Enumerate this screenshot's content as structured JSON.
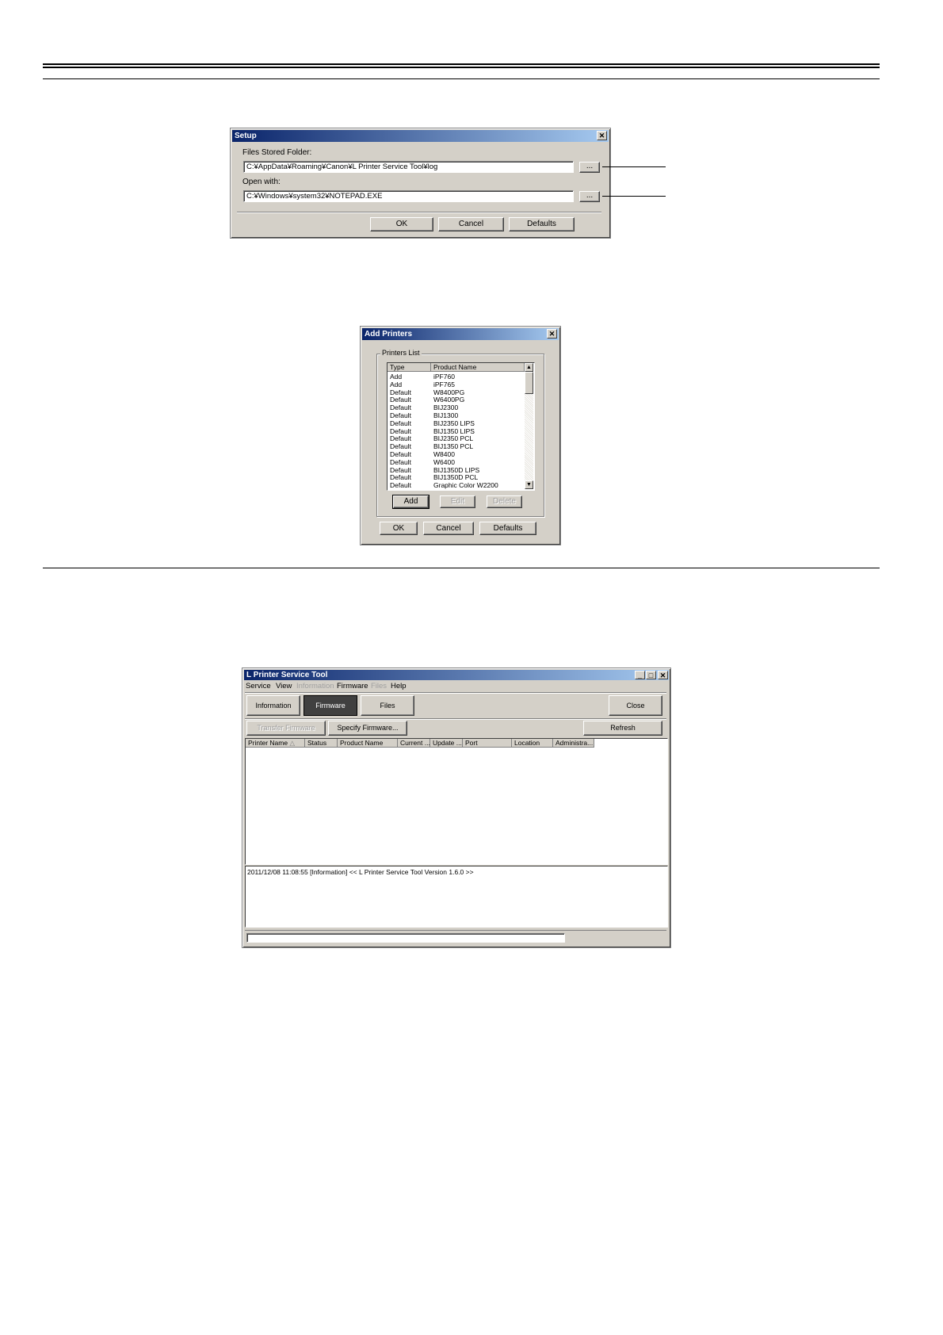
{
  "setup_dialog": {
    "title": "Setup",
    "close_glyph": "✕",
    "files_stored_folder_label": "Files Stored Folder:",
    "files_stored_folder_value": "C:¥AppData¥Roaming¥Canon¥L Printer Service Tool¥log",
    "browse_label": "...",
    "open_with_label": "Open with:",
    "open_with_value": "C:¥Windows¥system32¥NOTEPAD.EXE",
    "ok_label": "OK",
    "cancel_label": "Cancel",
    "defaults_label": "Defaults"
  },
  "add_printers_dialog": {
    "title": "Add Printers",
    "close_glyph": "✕",
    "group_label": "Printers List",
    "columns": [
      "Type",
      "Product Name"
    ],
    "rows": [
      [
        "Add",
        "iPF760"
      ],
      [
        "Add",
        "iPF765"
      ],
      [
        "Default",
        "W8400PG"
      ],
      [
        "Default",
        "W6400PG"
      ],
      [
        "Default",
        "BIJ2300"
      ],
      [
        "Default",
        "BIJ1300"
      ],
      [
        "Default",
        "BIJ2350 LIPS"
      ],
      [
        "Default",
        "BIJ1350 LIPS"
      ],
      [
        "Default",
        "BIJ2350 PCL"
      ],
      [
        "Default",
        "BIJ1350 PCL"
      ],
      [
        "Default",
        "W8400"
      ],
      [
        "Default",
        "W6400"
      ],
      [
        "Default",
        "BIJ1350D LIPS"
      ],
      [
        "Default",
        "BIJ1350D PCL"
      ],
      [
        "Default",
        "Graphic Color W2200"
      ]
    ],
    "add_label": "Add",
    "edit_label": "Edit",
    "delete_label": "Delete",
    "ok_label": "OK",
    "cancel_label": "Cancel",
    "defaults_label": "Defaults"
  },
  "service_tool_window": {
    "title": "L Printer Service Tool",
    "minimize_glyph": "_",
    "maximize_glyph": "□",
    "close_glyph": "✕",
    "menu": [
      "Service",
      "View",
      "Information",
      "Firmware",
      "Files",
      "Help"
    ],
    "tab_information": "Information",
    "tab_firmware": "Firmware",
    "tab_files": "Files",
    "close_label": "Close",
    "transfer_firmware_label": "Transfer Firmware",
    "specify_firmware_label": "Specify Firmware...",
    "refresh_label": "Refresh",
    "columns": [
      "Printer Name",
      "Status",
      "Product Name",
      "Current ...",
      "Update ...",
      "Port",
      "Location",
      "Administra..."
    ],
    "sort_glyph": "△",
    "log_line": "2011/12/08 11:08:55 [Information]   << L Printer Service Tool  Version 1.6.0 >>"
  }
}
